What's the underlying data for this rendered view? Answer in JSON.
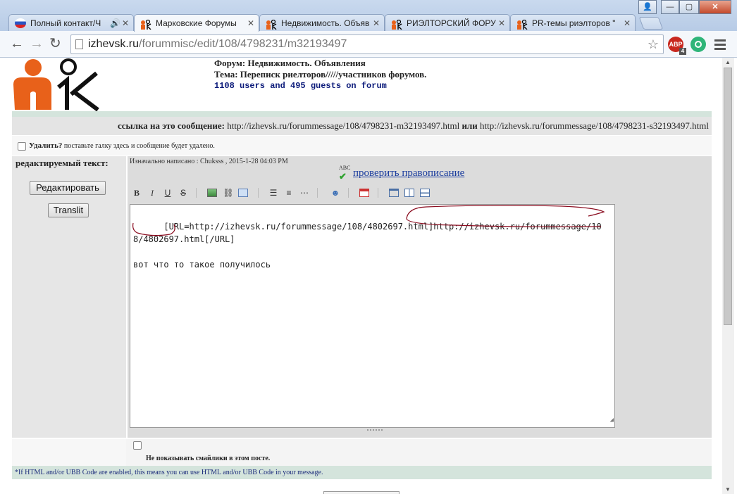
{
  "browser": {
    "tabs": [
      {
        "label": "Полный контакт/Ч",
        "active": false,
        "audio": true
      },
      {
        "label": "Марковские Форумы",
        "active": true,
        "audio": false
      },
      {
        "label": "Недвижимость. Объяв",
        "active": false,
        "audio": false
      },
      {
        "label": "РИЭЛТОРСКИЙ ФОРУ",
        "active": false,
        "audio": false
      },
      {
        "label": "PR-темы риэлторов \"",
        "active": false,
        "audio": false
      }
    ],
    "url_host": "izhevsk.ru",
    "url_path": "/forummisc/edit/108/4798231/m32193497",
    "ext_abp": "ABP",
    "ext_abp_badge": "4"
  },
  "forum": {
    "forum_label": "Форум:",
    "forum_name": "Недвижимость. Объявления",
    "topic_label": "Тема:",
    "topic_name": "Переписк риелторов/////участников форумов.",
    "online": "1108 users and 495 guests on forum"
  },
  "linkbar": {
    "label": "ссылка на это сообщение:",
    "url1": "http://izhevsk.ru/forummessage/108/4798231-m32193497.html",
    "or": "или",
    "url2": "http://izhevsk.ru/forummessage/108/4798231-s32193497.html"
  },
  "delete_row": {
    "label": "Удалить?",
    "hint": "поставьте галку здесь и сообщение будет удалено."
  },
  "left": {
    "title": "редактируемый текст:",
    "edit_button": "Редактировать",
    "translit_button": "Translit"
  },
  "editor": {
    "originally": "Изначально написано : Chuksss , 2015-1-28 04:03 PM",
    "spellcheck": "проверить правописание",
    "abc": "ABC",
    "content": "[URL=http://izhevsk.ru/forummessage/108/4802697.html]http://izhevsk.ru/forummessage/108/4802697.html[/URL]\n\nвот что то такое получилось"
  },
  "smilies": {
    "label": "Не показывать смайлики в этом посте."
  },
  "footnote": "*If HTML and/or UBB Code are enabled, this means you can use HTML and/or UBB Code in your message.",
  "icons": {
    "bold": "B",
    "italic": "I",
    "underline": "U",
    "strike": "S"
  }
}
